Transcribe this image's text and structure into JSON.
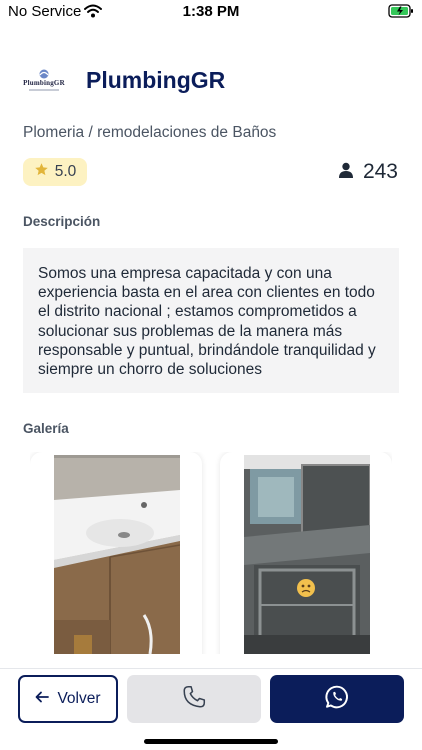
{
  "status_bar": {
    "carrier": "No Service",
    "time": "1:38 PM"
  },
  "header": {
    "logo_text": "PlumbingGR",
    "company_name": "PlumbingGR"
  },
  "category": "Plomeria / remodelaciones de Baños",
  "rating": {
    "value": "5.0"
  },
  "count": {
    "value": "243"
  },
  "description": {
    "title": "Descripción",
    "text": "Somos una empresa capacitada y con una experiencia basta en el area con clientes en todo el distrito nacional ; estamos comprometidos a solucionar sus problemas de la manera más responsable y puntual, brindándole tranquilidad y siempre un chorro de soluciones"
  },
  "gallery": {
    "title": "Galería",
    "photos": [
      "bathroom-vanity-photo",
      "bathroom-cabinet-photo"
    ]
  },
  "actions": {
    "back_label": "Volver"
  },
  "colors": {
    "brand": "#0b1d5a",
    "rating_bg": "#fdf2c2",
    "star": "#e2b53a",
    "call_bg": "#e4e4e7"
  }
}
